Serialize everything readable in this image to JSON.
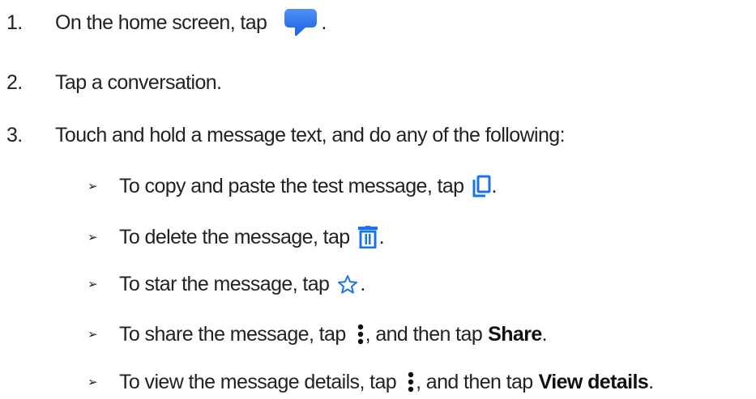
{
  "steps": [
    {
      "number": "1.",
      "text": "On the home screen, tap",
      "icon": "messages-app-icon",
      "trail": "."
    },
    {
      "number": "2.",
      "text": "Tap a conversation."
    },
    {
      "number": "3.",
      "text": "Touch and hold a message text, and do any of the following:"
    }
  ],
  "subitems": [
    {
      "bullet": "➢",
      "text": "To copy and paste the test message, tap",
      "icon": "copy-icon",
      "trail": "."
    },
    {
      "bullet": "➢",
      "text": "To delete the message, tap",
      "icon": "trash-icon",
      "trail": "."
    },
    {
      "bullet": "➢",
      "text": "To star the message, tap",
      "icon": "star-icon",
      "trail": "."
    },
    {
      "bullet": "➢",
      "text": "To share the message, tap",
      "icon": "more-vert-icon",
      "trail": ", and then tap",
      "bold": "Share",
      "end": "."
    },
    {
      "bullet": "➢",
      "text": "To view the message details, tap",
      "icon": "more-vert-icon",
      "trail": ", and then tap",
      "bold": "View details",
      "end": "."
    }
  ],
  "colors": {
    "accent": "#1a73e8",
    "text": "#222222"
  }
}
